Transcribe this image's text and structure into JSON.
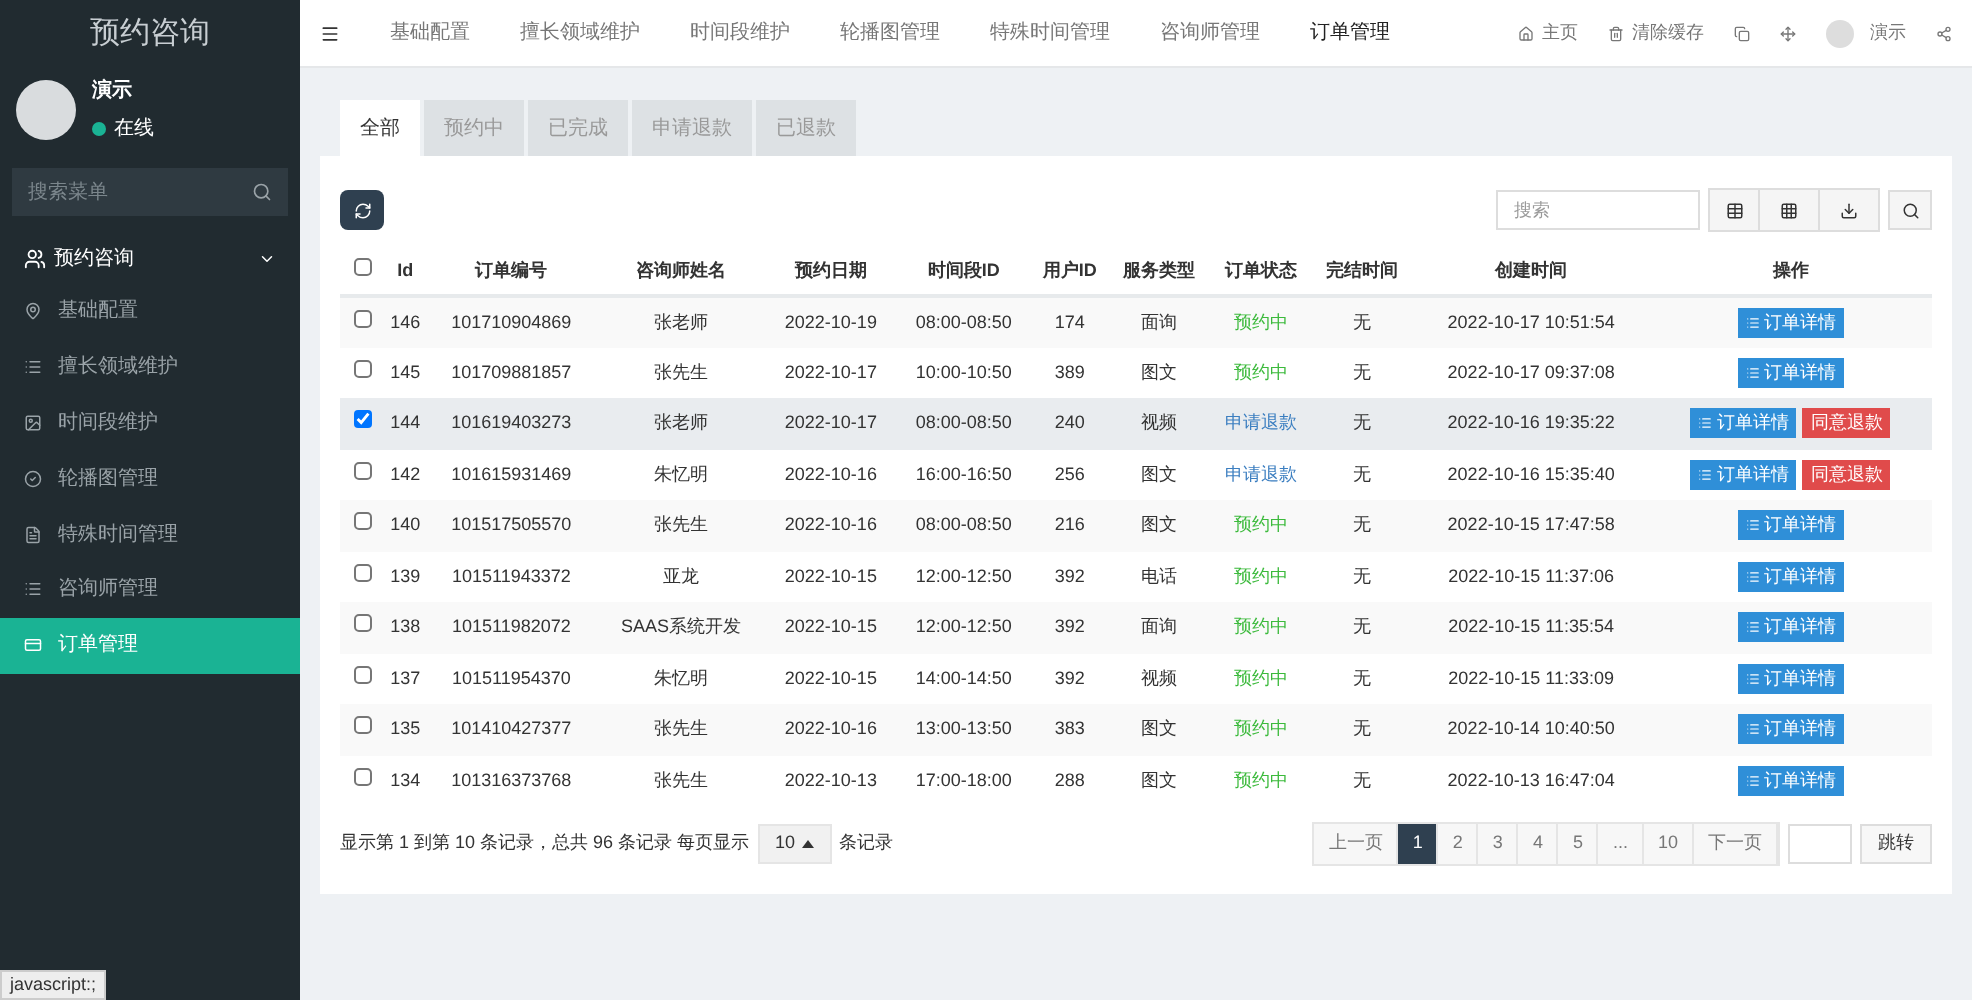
{
  "sidebar": {
    "title": "预约咨询",
    "user": {
      "name": "演示",
      "status": "在线"
    },
    "search": {
      "placeholder": "搜索菜单"
    },
    "menu": {
      "label": "预约咨询",
      "expanded": true,
      "items": [
        {
          "label": "基础配置",
          "selected": false
        },
        {
          "label": "擅长领域维护",
          "selected": false
        },
        {
          "label": "时间段维护",
          "selected": false
        },
        {
          "label": "轮播图管理",
          "selected": false
        },
        {
          "label": "特殊时间管理",
          "selected": false
        },
        {
          "label": "咨询师管理",
          "selected": false
        },
        {
          "label": "订单管理",
          "selected": true
        }
      ]
    }
  },
  "topnav": {
    "items": [
      {
        "label": "基础配置",
        "selected": false
      },
      {
        "label": "擅长领域维护",
        "selected": false
      },
      {
        "label": "时间段维护",
        "selected": false
      },
      {
        "label": "轮播图管理",
        "selected": false
      },
      {
        "label": "特殊时间管理",
        "selected": false
      },
      {
        "label": "咨询师管理",
        "selected": false
      },
      {
        "label": "订单管理",
        "selected": true
      }
    ],
    "right": {
      "home": "主页",
      "clear": "清除缓存",
      "user": "演示"
    }
  },
  "tabs": [
    {
      "label": "全部",
      "selected": true
    },
    {
      "label": "预约中",
      "selected": false
    },
    {
      "label": "已完成",
      "selected": false
    },
    {
      "label": "申请退款",
      "selected": false
    },
    {
      "label": "已退款",
      "selected": false
    }
  ],
  "toolbar": {
    "search": {
      "placeholder": "搜索"
    }
  },
  "table": {
    "select_all": {
      "checked": false
    },
    "columns": [
      "Id",
      "订单编号",
      "咨询师姓名",
      "预约日期",
      "时间段ID",
      "用户ID",
      "服务类型",
      "订单状态",
      "完结时间",
      "创建时间",
      "操作"
    ],
    "rows": [
      {
        "checked": false,
        "cells": [
          "146",
          "101710904869",
          "张老师",
          "2022-10-19",
          "08:00-08:50",
          "174",
          "面询",
          "预约中",
          "无",
          "2022-10-17 10:51:54"
        ],
        "kind": "pending",
        "actions": [
          "订单详情"
        ]
      },
      {
        "checked": false,
        "cells": [
          "145",
          "101709881857",
          "张先生",
          "2022-10-17",
          "10:00-10:50",
          "389",
          "图文",
          "预约中",
          "无",
          "2022-10-17 09:37:08"
        ],
        "kind": "pending",
        "actions": [
          "订单详情"
        ]
      },
      {
        "checked": true,
        "cells": [
          "144",
          "101619403273",
          "张老师",
          "2022-10-17",
          "08:00-08:50",
          "240",
          "视频",
          "申请退款",
          "无",
          "2022-10-16 19:35:22"
        ],
        "kind": "refund",
        "actions": [
          "订单详情",
          "同意退款"
        ]
      },
      {
        "checked": false,
        "cells": [
          "142",
          "101615931469",
          "朱忆明",
          "2022-10-16",
          "16:00-16:50",
          "256",
          "图文",
          "申请退款",
          "无",
          "2022-10-16 15:35:40"
        ],
        "kind": "refund",
        "actions": [
          "订单详情",
          "同意退款"
        ]
      },
      {
        "checked": false,
        "cells": [
          "140",
          "101517505570",
          "张先生",
          "2022-10-16",
          "08:00-08:50",
          "216",
          "图文",
          "预约中",
          "无",
          "2022-10-15 17:47:58"
        ],
        "kind": "pending",
        "actions": [
          "订单详情"
        ]
      },
      {
        "checked": false,
        "cells": [
          "139",
          "101511943372",
          "亚龙",
          "2022-10-15",
          "12:00-12:50",
          "392",
          "电话",
          "预约中",
          "无",
          "2022-10-15 11:37:06"
        ],
        "kind": "pending",
        "actions": [
          "订单详情"
        ]
      },
      {
        "checked": false,
        "cells": [
          "138",
          "101511982072",
          "SAAS系统开发",
          "2022-10-15",
          "12:00-12:50",
          "392",
          "面询",
          "预约中",
          "无",
          "2022-10-15 11:35:54"
        ],
        "kind": "pending",
        "actions": [
          "订单详情"
        ]
      },
      {
        "checked": false,
        "cells": [
          "137",
          "101511954370",
          "朱忆明",
          "2022-10-15",
          "14:00-14:50",
          "392",
          "视频",
          "预约中",
          "无",
          "2022-10-15 11:33:09"
        ],
        "kind": "pending",
        "actions": [
          "订单详情"
        ]
      },
      {
        "checked": false,
        "cells": [
          "135",
          "101410427377",
          "张先生",
          "2022-10-16",
          "13:00-13:50",
          "383",
          "图文",
          "预约中",
          "无",
          "2022-10-14 10:40:50"
        ],
        "kind": "pending",
        "actions": [
          "订单详情"
        ]
      },
      {
        "checked": false,
        "cells": [
          "134",
          "101316373768",
          "张先生",
          "2022-10-13",
          "17:00-18:00",
          "288",
          "图文",
          "预约中",
          "无",
          "2022-10-13 16:47:04"
        ],
        "kind": "pending",
        "actions": [
          "订单详情"
        ]
      }
    ]
  },
  "footer": {
    "summary": "显示第 1 到第 10 条记录，总共 96 条记录 每页显示",
    "page_size": "10",
    "suffix": "条记录",
    "pages": [
      {
        "label": "上一页",
        "selected": false
      },
      {
        "label": "1",
        "selected": true
      },
      {
        "label": "2",
        "selected": false
      },
      {
        "label": "3",
        "selected": false
      },
      {
        "label": "4",
        "selected": false
      },
      {
        "label": "5",
        "selected": false
      },
      {
        "label": "...",
        "selected": false
      },
      {
        "label": "10",
        "selected": false
      },
      {
        "label": "下一页",
        "selected": false
      }
    ],
    "jump": "跳转"
  },
  "status_bar": "javascript:;"
}
